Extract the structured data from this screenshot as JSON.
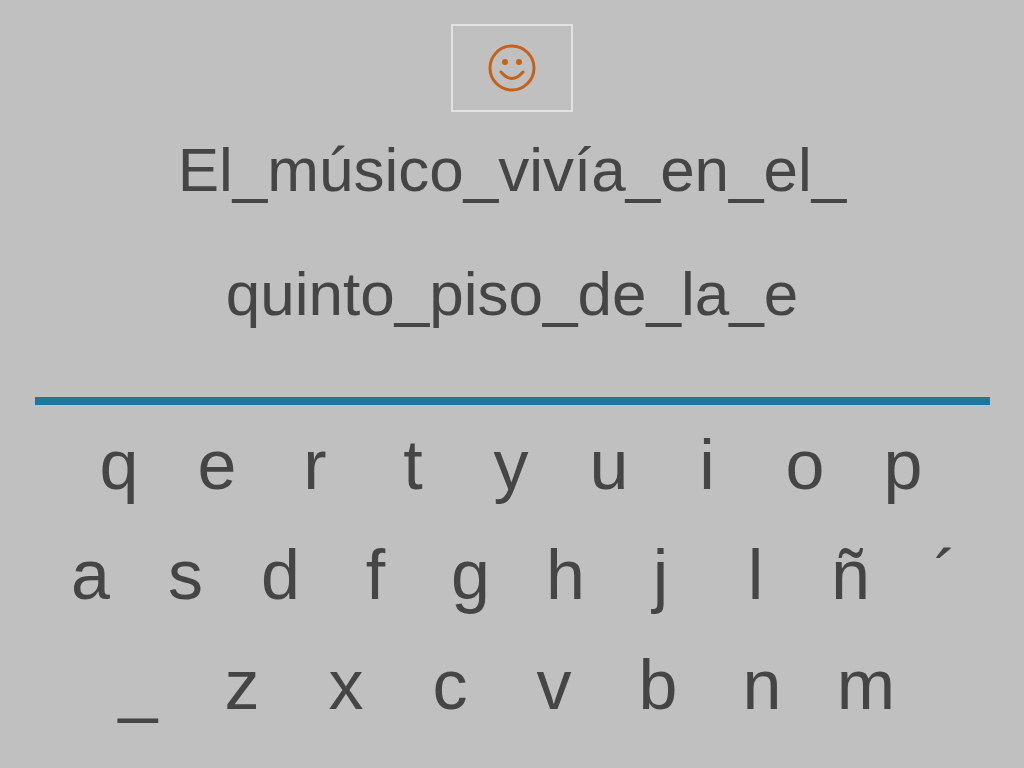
{
  "sentence_lines": [
    "El_músico_vivía_en_el_",
    "quinto_piso_de_la_e"
  ],
  "keyboard": {
    "rows": [
      [
        "q",
        "e",
        "r",
        "t",
        "y",
        "u",
        "i",
        "o",
        "p"
      ],
      [
        "a",
        "s",
        "d",
        "f",
        "g",
        "h",
        "j",
        "l",
        "ñ",
        "´"
      ],
      [
        "_",
        "z",
        "x",
        "c",
        "v",
        "b",
        "n",
        "m"
      ]
    ]
  }
}
